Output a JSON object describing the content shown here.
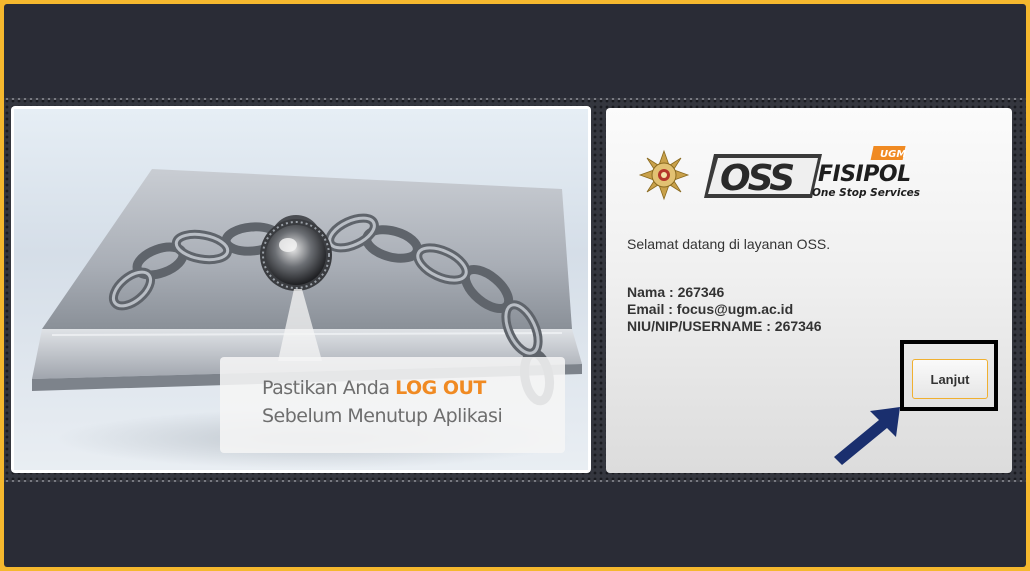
{
  "banner": {
    "caption_line1_prefix": "Pastikan Anda ",
    "caption_line1_accent": "LOG OUT",
    "caption_line2": "Sebelum Menutup Aplikasi"
  },
  "logo": {
    "badge": "UGM",
    "oss": "OSS",
    "fisipol": "FISIPOL",
    "tagline": "One Stop Services"
  },
  "info": {
    "welcome": "Selamat datang di layanan OSS.",
    "nama": "Nama : 267346",
    "email": "Email : focus@ugm.ac.id",
    "niu": "NIU/NIP/USERNAME : 267346"
  },
  "actions": {
    "continue_label": "Lanjut"
  },
  "colors": {
    "outer_border": "#f5b82e",
    "background": "#2a2c36",
    "accent_orange": "#f08a22",
    "arrow": "#1a2f6e",
    "button_border": "#f0b030"
  },
  "icons": {
    "arrow": "arrow-pointer-icon",
    "emblem": "ugm-emblem-icon",
    "padlock": "padlock-icon"
  }
}
